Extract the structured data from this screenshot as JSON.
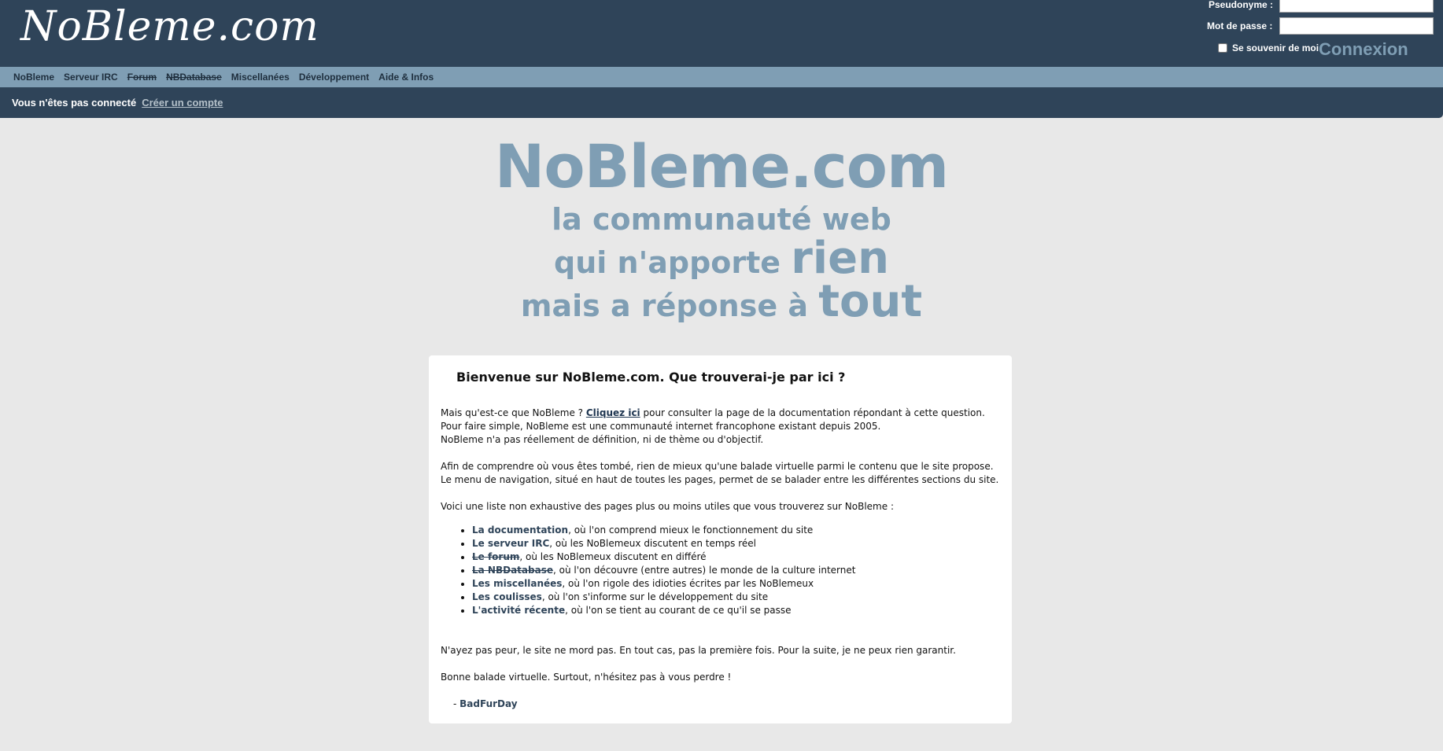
{
  "header": {
    "logo": "NoBleme.com",
    "login": {
      "username_label": "Pseudonyme :",
      "password_label": "Mot de passe :",
      "username_value": "",
      "password_value": "",
      "remember_label": "Se souvenir de moi",
      "connect_label": "Connexion"
    }
  },
  "nav": {
    "items": [
      {
        "label": "NoBleme",
        "strikethrough": false
      },
      {
        "label": "Serveur IRC",
        "strikethrough": false
      },
      {
        "label": "Forum",
        "strikethrough": true
      },
      {
        "label": "NBDatabase",
        "strikethrough": true
      },
      {
        "label": "Miscellanées",
        "strikethrough": false
      },
      {
        "label": "Développement",
        "strikethrough": false
      },
      {
        "label": "Aide & Infos",
        "strikethrough": false
      }
    ]
  },
  "subbar": {
    "status": "Vous n'êtes pas connecté",
    "create_account": "Créer un compte"
  },
  "hero": {
    "title": "NoBleme.com",
    "line1": "la communauté web",
    "line2_pre": "qui n'apporte ",
    "line2_emph": "rien",
    "line3_pre": "mais a réponse à ",
    "line3_emph": "tout"
  },
  "welcome": {
    "heading": "Bienvenue sur NoBleme.com. Que trouverai-je par ici ?",
    "p1_pre": "Mais qu'est-ce que NoBleme ? ",
    "p1_link": "Cliquez ici",
    "p1_post": " pour consulter la page de la documentation répondant à cette question.",
    "p2": "Pour faire simple, NoBleme est une communauté internet francophone existant depuis 2005.",
    "p3": "NoBleme n'a pas réellement de définition, ni de thème ou d'objectif.",
    "p4": "Afin de comprendre où vous êtes tombé, rien de mieux qu'une balade virtuelle parmi le contenu que le site propose.",
    "p5": "Le menu de navigation, situé en haut de toutes les pages, permet de se balader entre les différentes sections du site.",
    "p6": "Voici une liste non exhaustive des pages plus ou moins utiles que vous trouverez sur NoBleme :",
    "list": [
      {
        "link": "La documentation",
        "text": ", où l'on comprend mieux le fonctionnement du site"
      },
      {
        "link": "Le serveur IRC",
        "text": ", où les NoBlemeux discutent en temps réel"
      },
      {
        "link": "Le forum",
        "text": ", où les NoBlemeux discutent en différé"
      },
      {
        "link": "La NBDatabase",
        "text": ", où l'on découvre (entre autres) le monde de la culture internet"
      },
      {
        "link": "Les miscellanées",
        "text": ", où l'on rigole des idioties écrites par les NoBlemeux"
      },
      {
        "link": "Les coulisses",
        "text": ", où l'on s'informe sur le développement du site"
      },
      {
        "link": "L'activité récente",
        "text": ", où l'on se tient au courant de ce qu'il se passe"
      }
    ],
    "p7": "N'ayez pas peur, le site ne mord pas. En tout cas, pas la première fois. Pour la suite, je ne peux rien garantir.",
    "p8": "Bonne balade virtuelle. Surtout, n'hésitez pas à vous perdre !",
    "sig_prefix": "- ",
    "sig_name": "BadFurDay"
  },
  "colors": {
    "header_bg": "#2f4459",
    "nav_bg": "#7f9eb4",
    "page_bg": "#e8e8e8",
    "accent": "#7f9eb4",
    "link": "#2f4459"
  }
}
